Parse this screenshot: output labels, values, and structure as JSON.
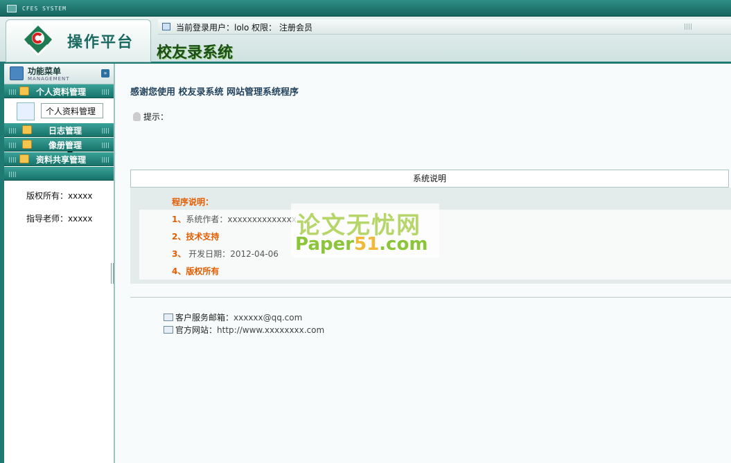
{
  "titlebar": {
    "app_title": "CFES SYSTEM"
  },
  "header": {
    "platform_title": "操作平台",
    "system_name": "校友录系统",
    "user_info": "当前登录用户：lolo 权限： 注册会员"
  },
  "sidebar": {
    "menu_title": "功能菜单",
    "menu_subtitle": "MANAGEMENT",
    "items": [
      {
        "label": "个人资料管理"
      },
      {
        "label": "日志管理"
      },
      {
        "label": "像册管理"
      },
      {
        "label": "资料共享管理"
      }
    ],
    "submenu_item": "个人资料管理",
    "copyright": "版权所有：xxxxx",
    "advisor": "指导老师：xxxxx"
  },
  "main": {
    "welcome": "感谢您使用  校友录系统  网站管理系统程序",
    "tip": "提示：",
    "desc_header": "系统说明",
    "desc_title": "程序说明：",
    "rows": [
      {
        "num": "1、",
        "label": "系统作者：",
        "value": "xxxxxxxxxxxxxx"
      },
      {
        "num": "2、",
        "label": "技术支持",
        "value": ""
      },
      {
        "num": "3、",
        "label": " 开发日期：",
        "value": "2012-04-06"
      },
      {
        "num": "4、",
        "label": "版权所有",
        "value": ""
      }
    ],
    "watermark_line1": "论文无忧网",
    "watermark_line2a": "Paper",
    "watermark_line2b": "51",
    "watermark_line2c": ".com",
    "email_label": "客户服务邮箱：",
    "email_value": "xxxxxx@qq.com",
    "site_label": "官方网站：",
    "site_value": "http://www.xxxxxxxx.com"
  }
}
